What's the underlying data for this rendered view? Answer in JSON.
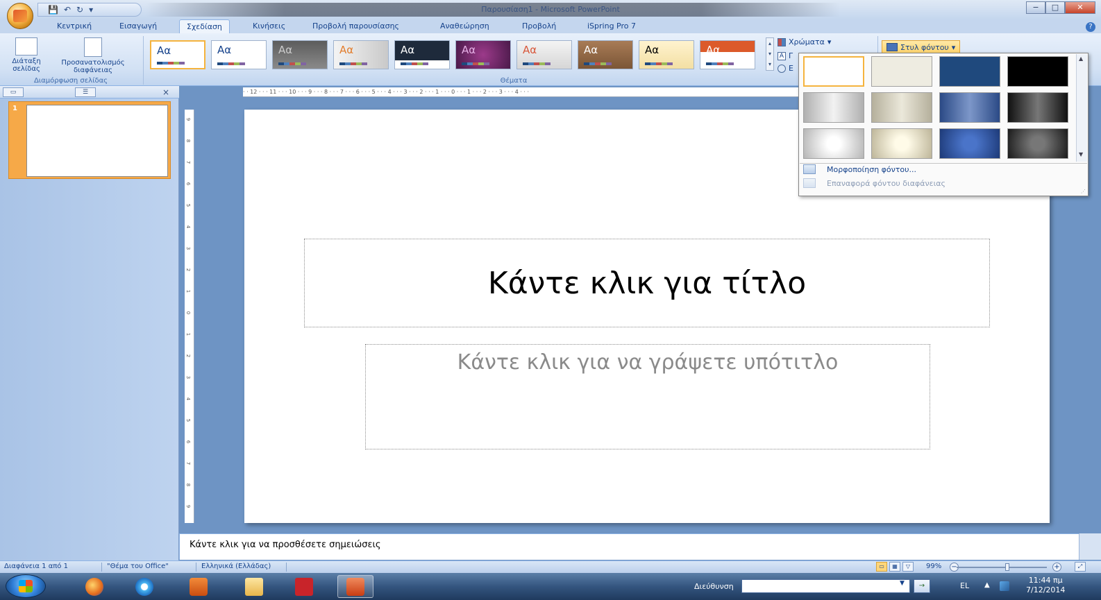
{
  "window": {
    "title": "Παρουσίαση1 - Microsoft PowerPoint",
    "controls": [
      "−",
      "□",
      "✕"
    ]
  },
  "qat": {
    "save": "💾",
    "undo": "↶",
    "redo": "↻",
    "more": "▾"
  },
  "tabs": [
    "Κεντρική",
    "Εισαγωγή",
    "Σχεδίαση",
    "Κινήσεις",
    "Προβολή παρουσίασης",
    "Αναθεώρηση",
    "Προβολή",
    "iSpring Pro 7"
  ],
  "active_tab": "Σχεδίαση",
  "ribbon": {
    "page_setup": {
      "btn1": "Διάταξη σελίδας",
      "btn2": "Προσανατολισμός διαφάνειας",
      "label": "Διαμόρφωση σελίδας"
    },
    "themes": {
      "label": "Θέματα",
      "sample": "Aα",
      "colors_label": "Χρώματα",
      "fonts_label": "Γ",
      "effects_label": "E"
    },
    "background_style_button": "Στυλ φόντου"
  },
  "dropdown": {
    "menu_format": "Μορφοποίηση φόντου...",
    "menu_reset": "Επαναφορά φόντου διαφάνειας"
  },
  "left_panel": {
    "slide_number": "1",
    "close": "×"
  },
  "ruler": {
    "horizontal": "· · 12 · · · 11 · · · 10 · · · 9 · · · 8 · · · 7 · · · 6 · · · 5 · · · 4 · · · 3 · · · 2 · · · 1 · · · 0 · · · 1 · · · 2 · · · 3 · · · 4 · · ·"
  },
  "slide": {
    "title_placeholder": "Κάντε κλικ για τίτλο",
    "subtitle_placeholder": "Κάντε κλικ για να γράψετε υπότιτλο"
  },
  "notes": "Κάντε κλικ για να προσθέσετε σημειώσεις",
  "status": {
    "slide_info": "Διαφάνεια 1 από 1",
    "theme_name": "\"Θέμα του Office\"",
    "language": "Ελληνικά (Ελλάδας)",
    "zoom": "99%"
  },
  "taskbar": {
    "address_label": "Διεύθυνση",
    "lang": "EL",
    "time": "11:44 πμ",
    "date": "7/12/2014"
  }
}
